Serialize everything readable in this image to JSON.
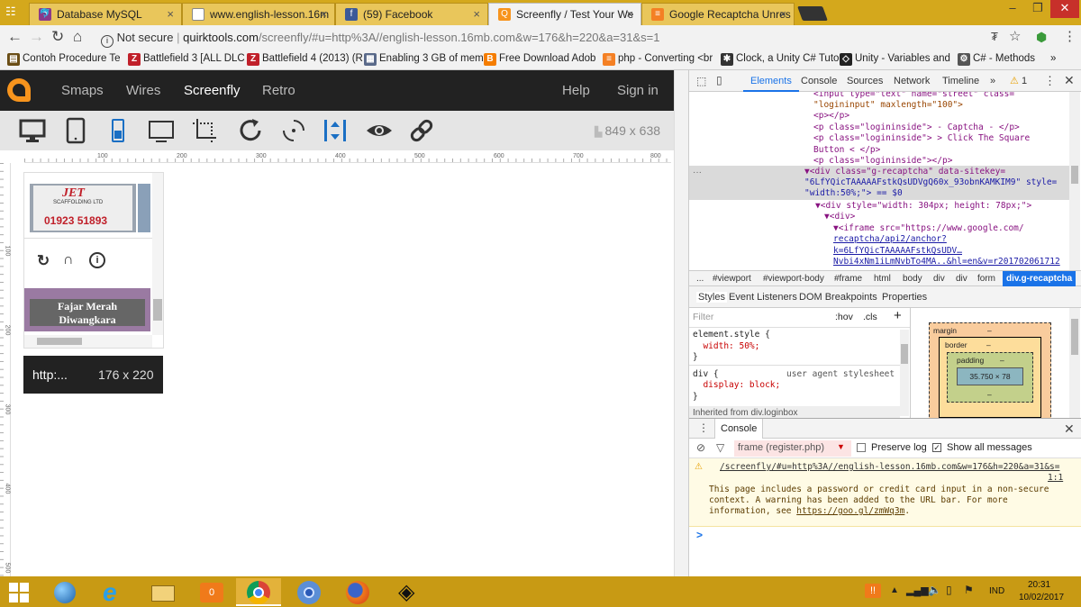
{
  "browser": {
    "tabs": [
      {
        "title": "Database MySQL",
        "icon": "mysql-icon",
        "active": false
      },
      {
        "title": "www.english-lesson.16m",
        "icon": "page-icon",
        "active": false
      },
      {
        "title": "(59) Facebook",
        "icon": "facebook-icon",
        "active": false
      },
      {
        "title": "Screenfly / Test Your We",
        "icon": "quirktools-icon",
        "active": true
      },
      {
        "title": "Google Recaptcha Unres",
        "icon": "stackoverflow-icon",
        "active": false
      }
    ],
    "address": {
      "security": "Not secure",
      "domain": "quirktools.com",
      "path": "/screenfly/#u=http%3A//english-lesson.16mb.com&w=176&h=220&a=31&s=1"
    },
    "bookmarks": [
      "Contoh Procedure Te",
      "Battlefield 3 [ALL DLC",
      "Battlefield 4 (2013) (R",
      "Enabling 3 GB of mem",
      "Free Download Adob",
      "php - Converting <br",
      "Clock, a Unity C# Tuto",
      "Unity - Variables and",
      "C# - Methods"
    ],
    "bookmarks_more": "»"
  },
  "app": {
    "nav": {
      "smaps": "Smaps",
      "wires": "Wires",
      "screenfly": "Screenfly",
      "retro": "Retro",
      "help": "Help",
      "signin": "Sign in"
    },
    "size_readout": "849 x 638",
    "ruler_ticks": [
      "100",
      "200",
      "300",
      "400",
      "500",
      "600",
      "700",
      "800"
    ],
    "vruler_ticks": [
      "100",
      "200",
      "300",
      "400",
      "500"
    ],
    "preview": {
      "sign_text_1": "JET",
      "sign_text_2": "SCAFFOLDING LTD",
      "sign_phone": "01923 51893",
      "caption_line1": "Fajar Merah",
      "caption_line2": "Diwangkara"
    },
    "url_label": "http:...",
    "device_size": "176 x 220"
  },
  "devtools": {
    "tabs": [
      "Elements",
      "Console",
      "Sources",
      "Network",
      "Timeline",
      "»"
    ],
    "warning_count": "1",
    "code_lines": [
      "\"logininput\" maxlength=\"100\">",
      "<p></p>",
      "<p class=\"logininside\"> - Captcha - </p>",
      "<p class=\"logininside\"> > Click The Square",
      "Button < </p>",
      "<p class=\"logininside\"></p>"
    ],
    "selected_line1": "▼<div class=\"g-recaptcha\" data-sitekey=",
    "selected_line2": "\"6LfYQicTAAAAAFstkQsUDVgQ60x_93obnKAMKIM9\" style=",
    "selected_line3": "\"width:50%;\"> == $0",
    "child_lines": [
      "▼<div style=\"width: 304px; height: 78px;\">",
      "▼<div>",
      "▼<iframe src=\"https://www.google.com/",
      "recaptcha/api2/anchor?",
      "k=6LfYQicTAAAAAFstkQsUDV…",
      "Nvbi4xNm1iLmNvbTo4MA..&hl=en&v=r201702061712"
    ],
    "breadcrumbs": [
      "...",
      "#viewport",
      "#viewport-body",
      "#frame",
      "html",
      "body",
      "div",
      "div",
      "form",
      "div.g-recaptcha"
    ],
    "subtabs": [
      "Styles",
      "Event Listeners",
      "DOM Breakpoints",
      "Properties"
    ],
    "filter_placeholder": "Filter",
    "hov": ":hov",
    "cls": ".cls",
    "styles": [
      "element.style {",
      "  width: 50%;",
      "}",
      "div {",
      "  display: block;",
      "}",
      "Inherited from div.loginbox"
    ],
    "ua_stylesheet": "user agent stylesheet",
    "boxmodel": {
      "margin": "margin",
      "border": "border",
      "padding": "padding",
      "content": "35.750 × 78",
      "dash": "–"
    },
    "console": {
      "title": "Console",
      "frame": "frame (register.php)",
      "preserve_log": "Preserve log",
      "show_all": "Show all messages",
      "warn_link": "/screenfly/#u=http%3A//english-lesson.16mb.com&w=176&h=220&a=31&s=",
      "warn_loc": "1:1",
      "warn_line1": "This page includes a password or credit card input in a non-secure",
      "warn_line2": "context. A warning has been added to the URL bar. For more",
      "warn_line3": "information, see ",
      "warn_url": "https://goo.gl/zmWq3m",
      "prompt": ">"
    }
  },
  "taskbar": {
    "lang": "IND",
    "time": "20:31",
    "date": "10/02/2017"
  },
  "colors": {
    "accent": "#f7941d",
    "tabbar": "#d4a81c",
    "taskbar": "#c89a14",
    "appheader": "#222222"
  }
}
